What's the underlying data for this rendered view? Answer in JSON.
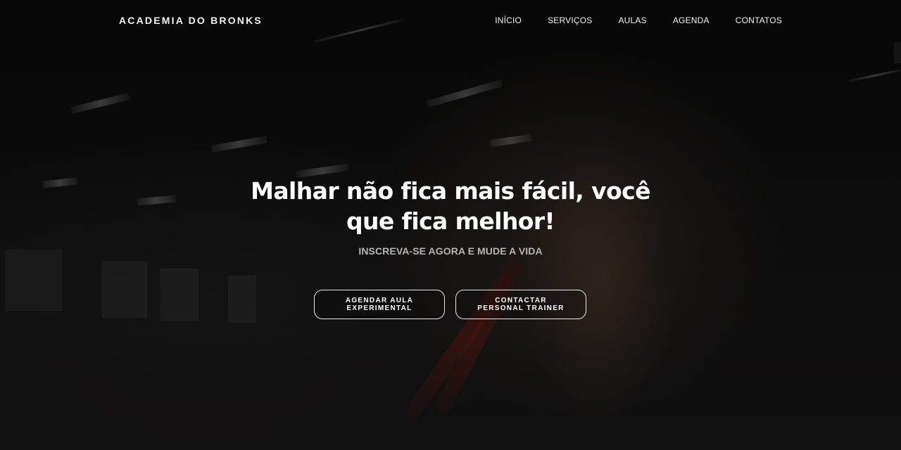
{
  "header": {
    "brand": "ACADEMIA DO BRONKS",
    "nav": [
      {
        "label": "INÍCIO"
      },
      {
        "label": "SERVIÇOS"
      },
      {
        "label": "AULAS"
      },
      {
        "label": "AGENDA"
      },
      {
        "label": "CONTATOS"
      }
    ]
  },
  "hero": {
    "headline": "Malhar não fica mais fácil, você que fica melhor!",
    "subheadline": "INSCREVA-SE AGORA E MUDE A VIDA",
    "buttons": [
      {
        "label": "AGENDAR AULA EXPERIMENTAL"
      },
      {
        "label": "CONTACTAR PERSONAL TRAINER"
      }
    ]
  },
  "colors": {
    "background": "#0d0d0d",
    "text": "#ffffff",
    "subtext": "#b5b5b5",
    "button_border": "#e8e8e8"
  }
}
